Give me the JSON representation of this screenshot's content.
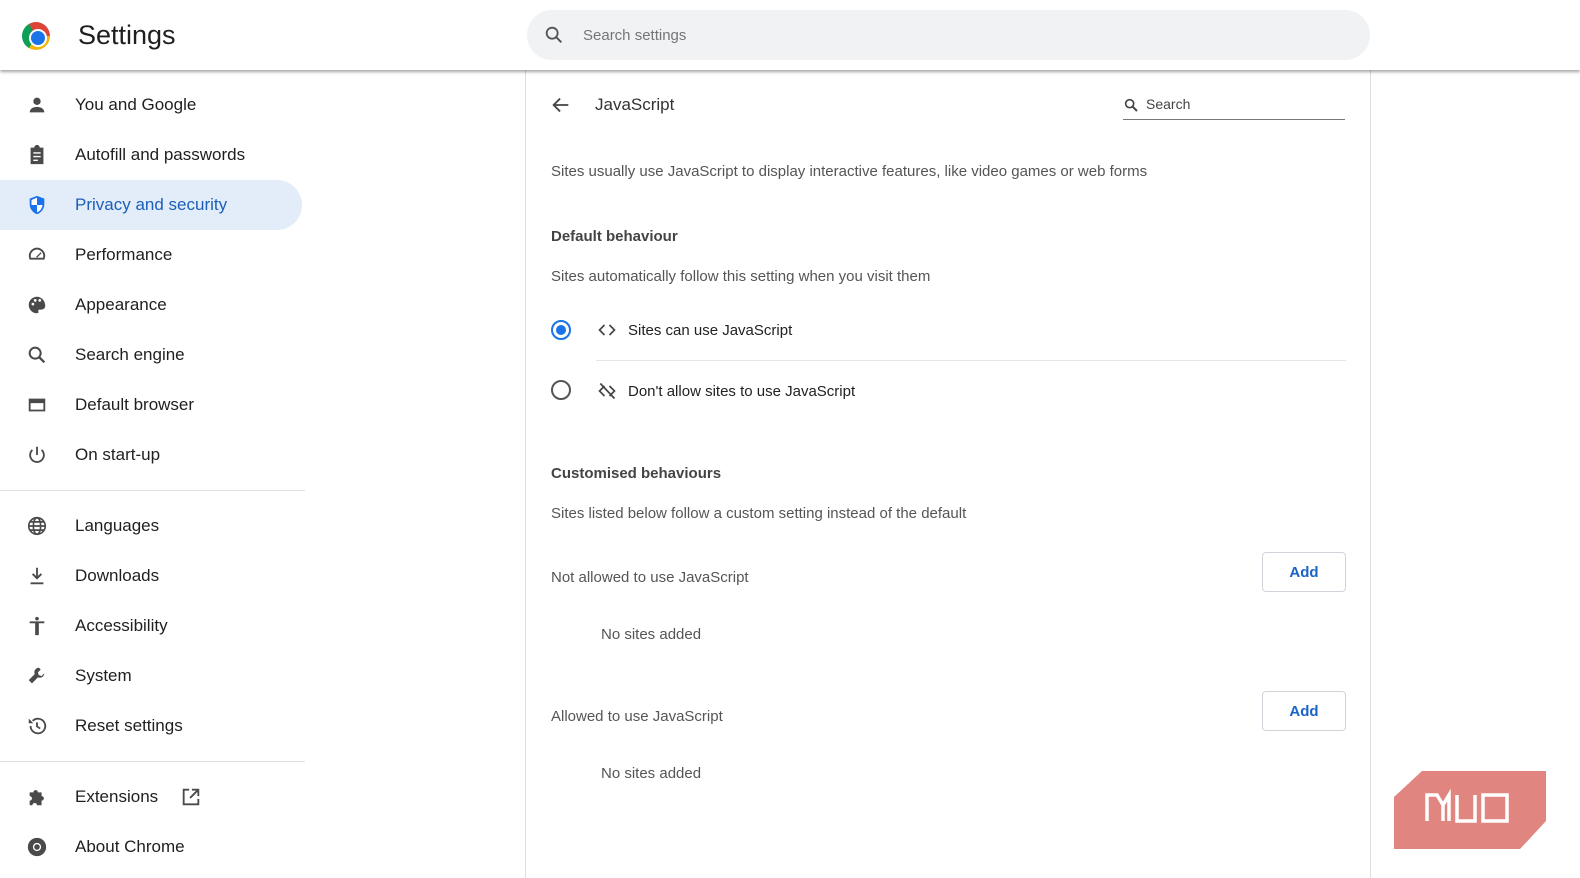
{
  "header": {
    "title": "Settings",
    "search_placeholder": "Search settings"
  },
  "sidebar": {
    "items": [
      {
        "label": "You and Google",
        "icon": "person-icon"
      },
      {
        "label": "Autofill and passwords",
        "icon": "clipboard-icon"
      },
      {
        "label": "Privacy and security",
        "icon": "shield-icon",
        "active": true
      },
      {
        "label": "Performance",
        "icon": "gauge-icon"
      },
      {
        "label": "Appearance",
        "icon": "palette-icon"
      },
      {
        "label": "Search engine",
        "icon": "search-icon"
      },
      {
        "label": "Default browser",
        "icon": "browser-icon"
      },
      {
        "label": "On start-up",
        "icon": "power-icon"
      },
      {
        "label": "Languages",
        "icon": "globe-icon"
      },
      {
        "label": "Downloads",
        "icon": "download-icon"
      },
      {
        "label": "Accessibility",
        "icon": "accessibility-icon"
      },
      {
        "label": "System",
        "icon": "wrench-icon"
      },
      {
        "label": "Reset settings",
        "icon": "history-icon"
      },
      {
        "label": "Extensions",
        "icon": "puzzle-icon"
      },
      {
        "label": "About Chrome",
        "icon": "chrome-icon"
      }
    ]
  },
  "page": {
    "title": "JavaScript",
    "search_placeholder": "Search",
    "description": "Sites usually use JavaScript to display interactive features, like video games or web forms",
    "default_heading": "Default behaviour",
    "default_sub": "Sites automatically follow this setting when you visit them",
    "options": [
      {
        "label": "Sites can use JavaScript",
        "selected": true
      },
      {
        "label": "Don't allow sites to use JavaScript",
        "selected": false
      }
    ],
    "custom_heading": "Customised behaviours",
    "custom_sub": "Sites listed below follow a custom setting instead of the default",
    "not_allowed_label": "Not allowed to use JavaScript",
    "allowed_label": "Allowed to use JavaScript",
    "add_label": "Add",
    "empty_label": "No sites added"
  },
  "watermark": "MUO"
}
